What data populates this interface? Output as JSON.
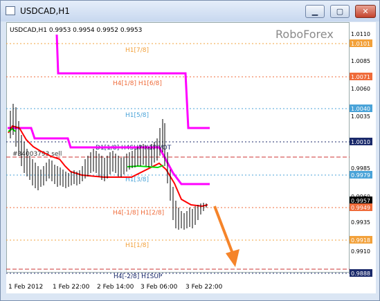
{
  "window": {
    "title": "USDCAD,H1",
    "buttons": {
      "minimize": "▁",
      "maximize": "▢",
      "close": "✕"
    }
  },
  "chart": {
    "header": "USDCAD,H1  0.9953 0.9954 0.9952 0.9953",
    "watermark": "RoboForex",
    "order_label": "#34003793 sell",
    "level_labels": {
      "h1_7_8": "H1[7/8]",
      "h4_1_8_h1_6_8": "H4[1/8] H1[6/8]",
      "h1_5_8": "H1[5/8]",
      "d1_pivot": "D1[1/8] H4SUP H1PIVOT",
      "h1_3_8": "H1[3/8]",
      "h4_m1_8_h1_2_8": "H4[-1/8] H1[2/8]",
      "h1_1_8": "H1[1/8]",
      "h4_m2_8_h1sup": "H4[-2/8] H1SUP"
    },
    "price_ticks": [
      "1.0110",
      "1.0085",
      "1.0060",
      "1.0035",
      "0.9985",
      "0.9960",
      "0.9935",
      "0.9910"
    ],
    "price_highlights": [
      {
        "label": "1.0101",
        "color": "#f2a13b"
      },
      {
        "label": "1.0071",
        "color": "#ef6b3a"
      },
      {
        "label": "1.0040",
        "color": "#4aa3d8"
      },
      {
        "label": "1.0010",
        "color": "#1b2a6b"
      },
      {
        "label": "0.9979",
        "color": "#4aa3d8"
      },
      {
        "label": "0.9957",
        "color": "#000000"
      },
      {
        "label": "0.9949",
        "color": "#ef6b3a"
      },
      {
        "label": "0.9918",
        "color": "#f2a13b"
      },
      {
        "label": "0.9888",
        "color": "#1b2a6b"
      }
    ],
    "time_labels": [
      "1 Feb 2012",
      "1 Feb 22:00",
      "2 Feb 14:00",
      "3 Feb 06:00",
      "3 Feb 22:00"
    ],
    "colors": {
      "magenta": "#ff00ff",
      "red": "#ff0000",
      "green": "#00ff00",
      "orange": "#f5842a",
      "candle": "#000000"
    }
  }
}
